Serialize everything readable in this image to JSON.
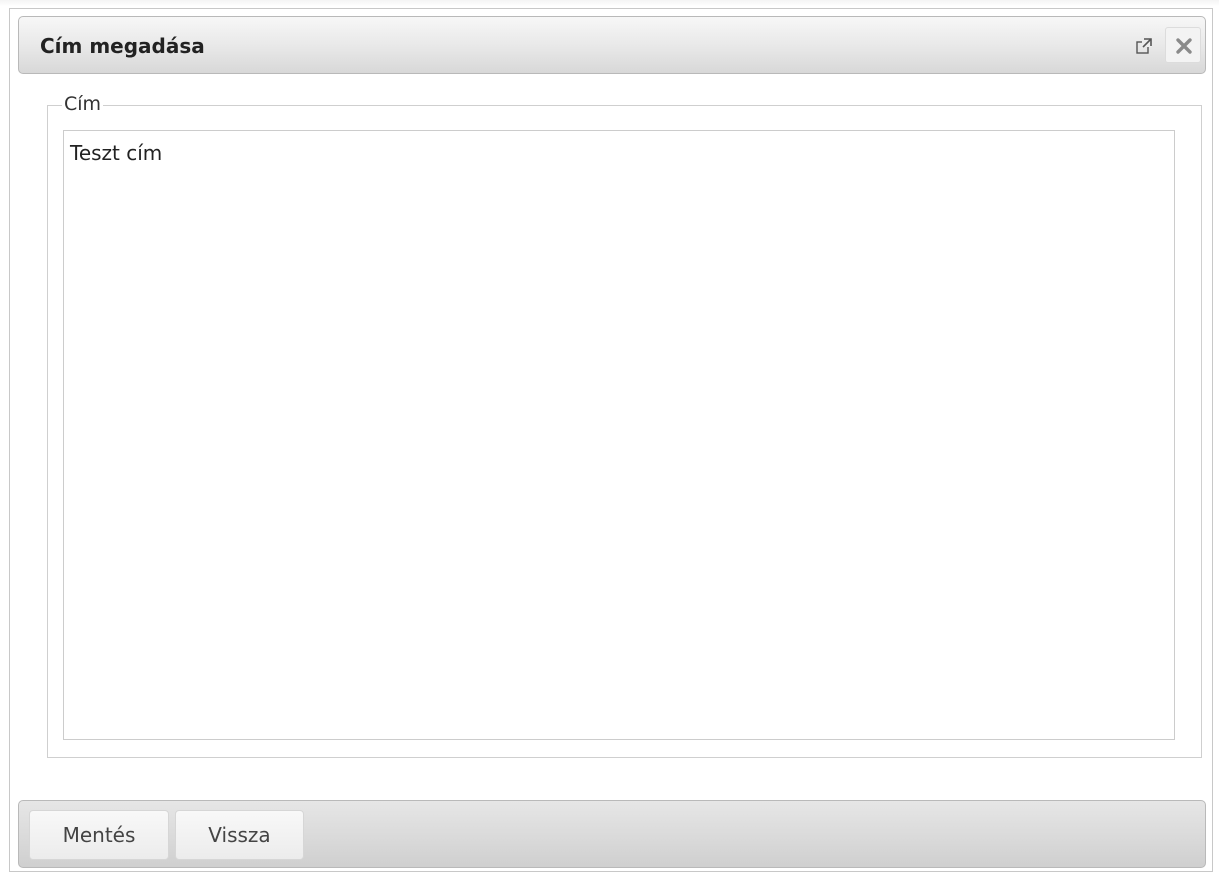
{
  "dialog": {
    "title": "Cím megadása",
    "popout_icon": "popout-icon",
    "close_icon": "close-icon"
  },
  "form": {
    "legend": "Cím",
    "textarea_value": "Teszt cím"
  },
  "footer": {
    "save_label": "Mentés",
    "back_label": "Vissza"
  },
  "colors": {
    "title_gradient_top": "#f7f7f7",
    "title_gradient_bottom": "#d8d8d8",
    "border": "#b9b9b9",
    "text": "#222222"
  }
}
